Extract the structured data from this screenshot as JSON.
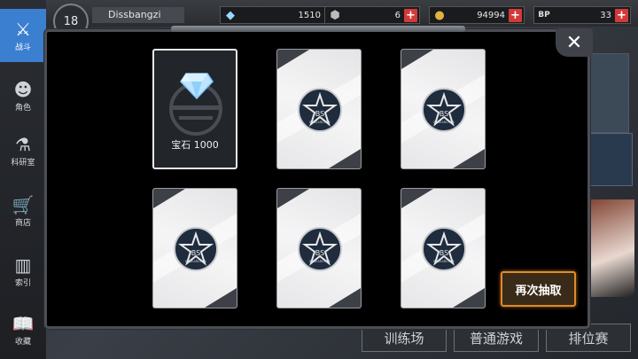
{
  "player": {
    "level": "18",
    "name": "Dissbangzi"
  },
  "resources": [
    {
      "icon": "crystal-icon",
      "value": "1510"
    },
    {
      "icon": "ore-icon",
      "value": "6"
    },
    {
      "icon": "coin-icon",
      "value": "94994"
    },
    {
      "icon": "bp-icon",
      "value": "33",
      "badge": "BP"
    }
  ],
  "nav": [
    {
      "label": "战斗",
      "icon": "crossed-swords-icon",
      "active": true
    },
    {
      "label": "角色",
      "icon": "character-icon"
    },
    {
      "label": "科研室",
      "icon": "flask-icon"
    },
    {
      "label": "商店",
      "icon": "cart-icon"
    },
    {
      "label": "索引",
      "icon": "books-icon"
    },
    {
      "label": "收藏",
      "icon": "open-book-icon"
    }
  ],
  "bottom_buttons": [
    "训练场",
    "普通游戏",
    "排位赛"
  ],
  "modal": {
    "revealed_card": {
      "label": "宝石 1000",
      "icon": "gem-icon"
    },
    "card_back_logo": {
      "top": "BS",
      "bottom": "RESEARCHER"
    },
    "draw_again_label": "再次抽取",
    "close_label": "✕"
  }
}
